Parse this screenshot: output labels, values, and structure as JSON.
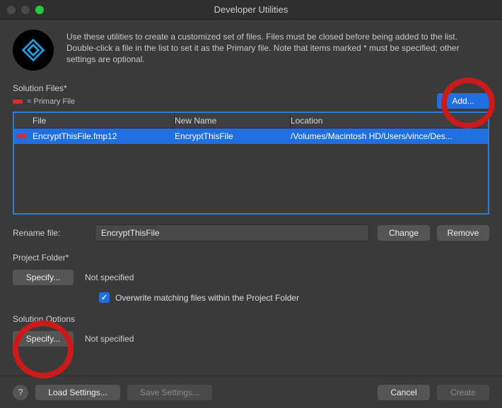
{
  "window": {
    "title": "Developer Utilities"
  },
  "intro": "Use these utilities to create a customized set of files. Files must be closed before being added to the list. Double-click a file in the list to set it as the Primary file. Note that items marked * must be specified; other settings are optional.",
  "solutionFiles": {
    "heading": "Solution Files*",
    "primary_legend": "= Primary File",
    "add_label": "Add...",
    "columns": {
      "file": "File",
      "newname": "New Name",
      "location": "Location"
    },
    "rows": [
      {
        "file": "EncryptThisFile.fmp12",
        "newname": "EncryptThisFile",
        "location": "/Volumes/Macintosh HD/Users/vince/Des..."
      }
    ]
  },
  "rename": {
    "label": "Rename file:",
    "value": "EncryptThisFile",
    "change_label": "Change",
    "remove_label": "Remove"
  },
  "projectFolder": {
    "heading": "Project Folder*",
    "specify_label": "Specify...",
    "status": "Not specified",
    "overwrite_label": "Overwrite matching files within the Project Folder",
    "overwrite_checked": true
  },
  "solutionOptions": {
    "heading": "Solution Options",
    "specify_label": "Specify...",
    "status": "Not specified"
  },
  "footer": {
    "help": "?",
    "load": "Load Settings...",
    "save": "Save Settings...",
    "cancel": "Cancel",
    "create": "Create"
  }
}
